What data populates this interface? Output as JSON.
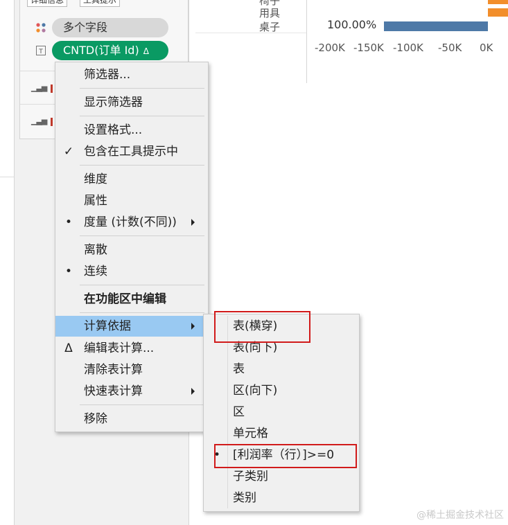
{
  "colors": {
    "pill_green": "#0a9a63",
    "menu_highlight": "#99c9f2",
    "bar_blue": "#4e79a7",
    "bar_orange": "#f28e2b",
    "annotation_red": "#d11a1a"
  },
  "marks_card": {
    "buttons": [
      "详细信息",
      "工具提示"
    ],
    "fields": [
      {
        "label": "多个字段",
        "icon": "color-dots-icon"
      },
      {
        "label": "CNTD(订单 Id)",
        "suffix": "Δ",
        "icon": "text-icon"
      }
    ]
  },
  "chart": {
    "categories": [
      "椅子",
      "用具",
      "桌子"
    ],
    "pct_label": "100.00%",
    "ticks": [
      "-200K",
      "-150K",
      "-100K",
      "-50K",
      "0K"
    ]
  },
  "chart_data": {
    "type": "bar",
    "categories": [
      "椅子",
      "用具",
      "桌子"
    ],
    "x_ticks": [
      "-200K",
      "-150K",
      "-100K",
      "-50K",
      "0K"
    ],
    "xlim": [
      -200000,
      0
    ],
    "data_labels": [
      "",
      "",
      "100.00%"
    ]
  },
  "context_menu": {
    "items": [
      {
        "label": "筛选器...",
        "mark": ""
      },
      {
        "label": "显示筛选器",
        "mark": ""
      },
      {
        "label": "设置格式...",
        "mark": ""
      },
      {
        "label": "包含在工具提示中",
        "mark": "✓"
      },
      {
        "label": "维度",
        "mark": ""
      },
      {
        "label": "属性",
        "mark": ""
      },
      {
        "label": "度量 (计数(不同))",
        "mark": "•"
      },
      {
        "label": "离散",
        "mark": ""
      },
      {
        "label": "连续",
        "mark": "•"
      },
      {
        "label": "在功能区中编辑",
        "mark": ""
      },
      {
        "label": "计算依据",
        "mark": ""
      },
      {
        "label": "编辑表计算...",
        "mark": "Δ"
      },
      {
        "label": "清除表计算",
        "mark": ""
      },
      {
        "label": "快速表计算",
        "mark": ""
      },
      {
        "label": "移除",
        "mark": ""
      }
    ]
  },
  "submenu": {
    "items": [
      {
        "label": "表(横穿)",
        "mark": ""
      },
      {
        "label": "表(向下)",
        "mark": ""
      },
      {
        "label": "表",
        "mark": ""
      },
      {
        "label": "区(向下)",
        "mark": ""
      },
      {
        "label": "区",
        "mark": ""
      },
      {
        "label": "单元格",
        "mark": ""
      },
      {
        "label": "[利润率（行）]>=0",
        "mark": "•"
      },
      {
        "label": "子类别",
        "mark": ""
      },
      {
        "label": "类别",
        "mark": ""
      }
    ]
  },
  "watermark": "@稀土掘金技术社区"
}
